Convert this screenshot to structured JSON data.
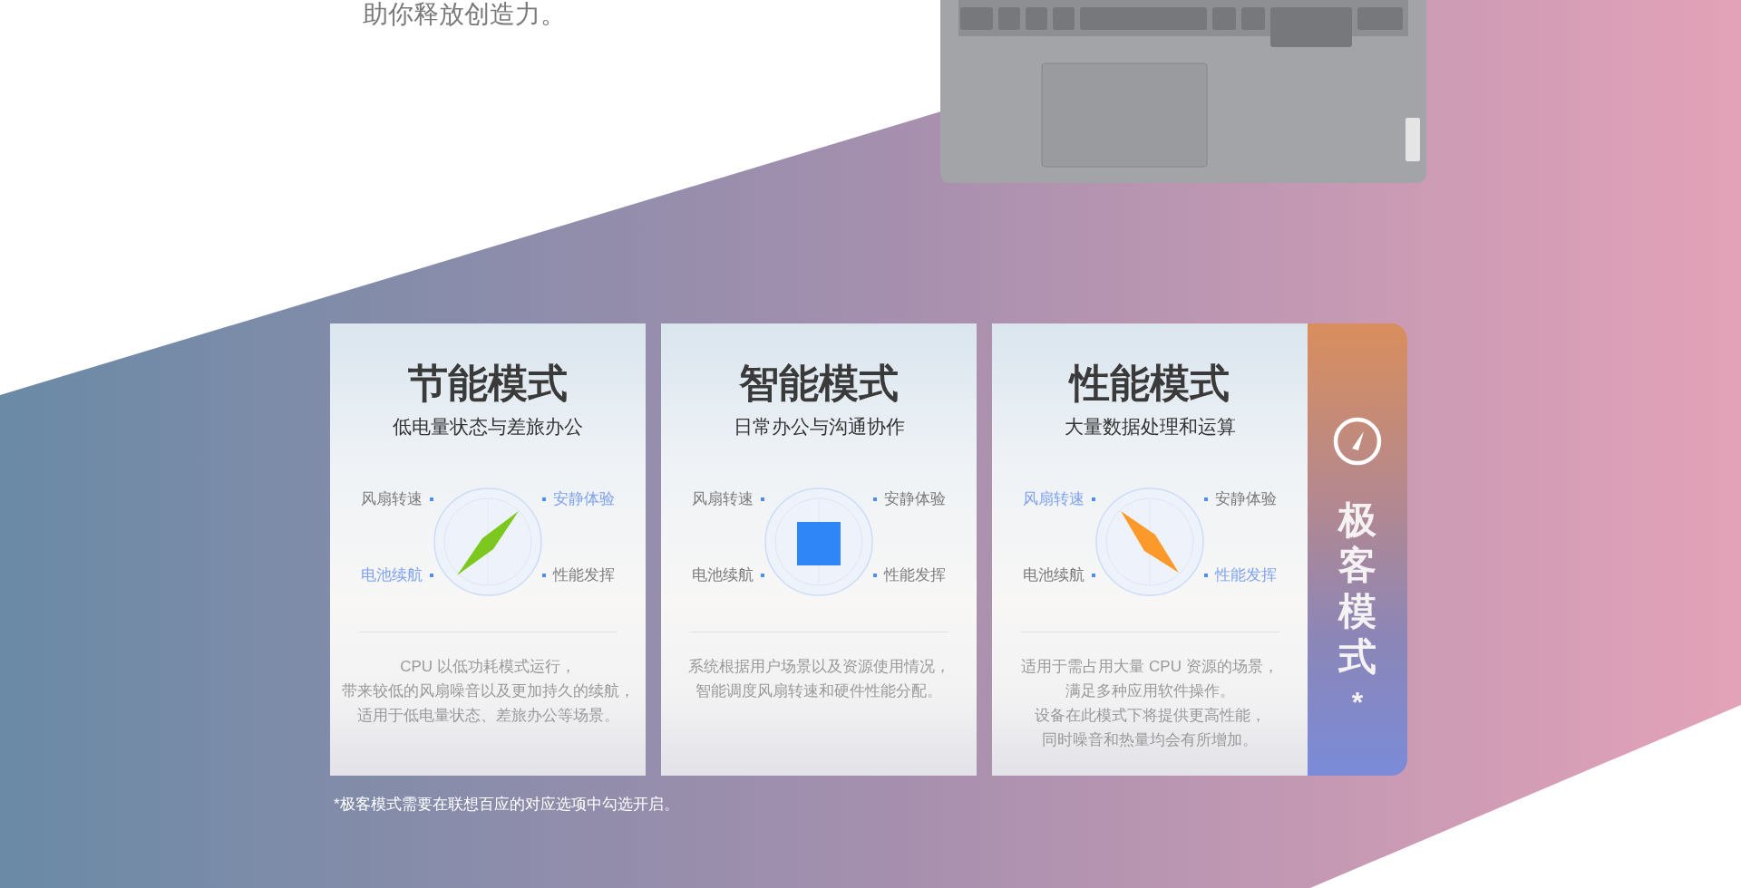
{
  "intro_tail": "助你释放创造力。",
  "modes": [
    {
      "title": "节能模式",
      "subtitle": "低电量状态与差旅办公",
      "labels": [
        {
          "text": "风扇转速",
          "highlighted": false
        },
        {
          "text": "安静体验",
          "highlighted": true
        },
        {
          "text": "电池续航",
          "highlighted": true
        },
        {
          "text": "性能发挥",
          "highlighted": false
        }
      ],
      "indicator": {
        "kind": "rising",
        "color": "#7cc81e"
      },
      "description": [
        "CPU 以低功耗模式运行，",
        "带来较低的风扇噪音以及更加持久的续航，",
        "适用于低电量状态、差旅办公等场景。"
      ]
    },
    {
      "title": "智能模式",
      "subtitle": "日常办公与沟通协作",
      "labels": [
        {
          "text": "风扇转速",
          "highlighted": false
        },
        {
          "text": "安静体验",
          "highlighted": false
        },
        {
          "text": "电池续航",
          "highlighted": false
        },
        {
          "text": "性能发挥",
          "highlighted": false
        }
      ],
      "indicator": {
        "kind": "square",
        "color": "#2f86f6"
      },
      "description": [
        "系统根据用户场景以及资源使用情况，",
        "智能调度风扇转速和硬件性能分配。"
      ]
    },
    {
      "title": "性能模式",
      "subtitle": "大量数据处理和运算",
      "labels": [
        {
          "text": "风扇转速",
          "highlighted": true
        },
        {
          "text": "安静体验",
          "highlighted": false
        },
        {
          "text": "电池续航",
          "highlighted": false
        },
        {
          "text": "性能发挥",
          "highlighted": true
        }
      ],
      "indicator": {
        "kind": "falling",
        "color": "#fb9a2a"
      },
      "description": [
        "适用于需占用大量 CPU 资源的场景，",
        "满足多种应用软件操作。",
        "设备在此模式下将提供更高性能，",
        "同时噪音和热量均会有所增加。"
      ]
    }
  ],
  "geek_tab": {
    "title": "极客模式",
    "mark": "*"
  },
  "footnote": "*极客模式需要在联想百应的对应选项中勾选开启。"
}
